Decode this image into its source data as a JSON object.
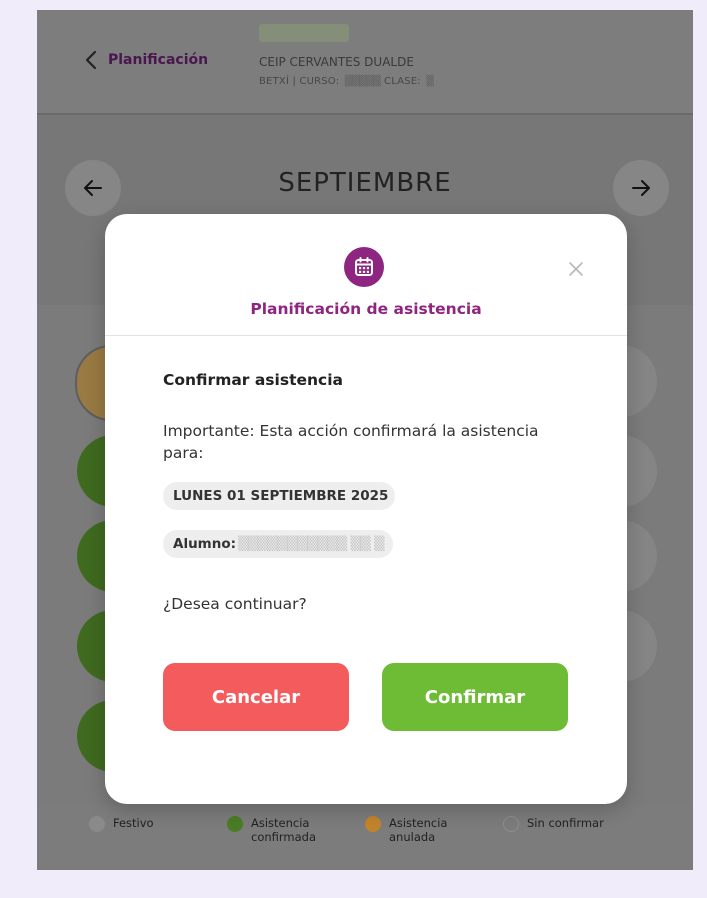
{
  "header": {
    "back_label": "Planificación",
    "school_name": "CEIP CERVANTES DUALDE",
    "school_meta": "BETXÍ | CURSO:",
    "school_meta_class": "CLASE:"
  },
  "calendar": {
    "month": "SEPTIEMBRE",
    "prev_icon": "arrow-left-icon",
    "next_icon": "arrow-right-icon"
  },
  "legend": [
    {
      "label": "Festivo",
      "color": "#8a8a8a"
    },
    {
      "label": "Asistencia confirmada",
      "color": "#4a7d25"
    },
    {
      "label": "Asistencia anulada",
      "color": "#c2842b"
    },
    {
      "label": "Sin confirmar",
      "color": "transparent"
    }
  ],
  "modal": {
    "icon": "calendar-icon",
    "title": "Planificación de asistencia",
    "section_title": "Confirmar asistencia",
    "message": "Importante: Esta acción confirmará la asistencia para:",
    "date_chip": "LUNES 01 SEPTIEMBRE 2025",
    "student_label": "Alumno:",
    "question": "¿Desea continuar?",
    "cancel_label": "Cancelar",
    "confirm_label": "Confirmar"
  },
  "colors": {
    "accent": "#8e2581",
    "cancel": "#f35b5d",
    "confirm": "#6ebb35",
    "overlay": "#7c7c7c"
  }
}
